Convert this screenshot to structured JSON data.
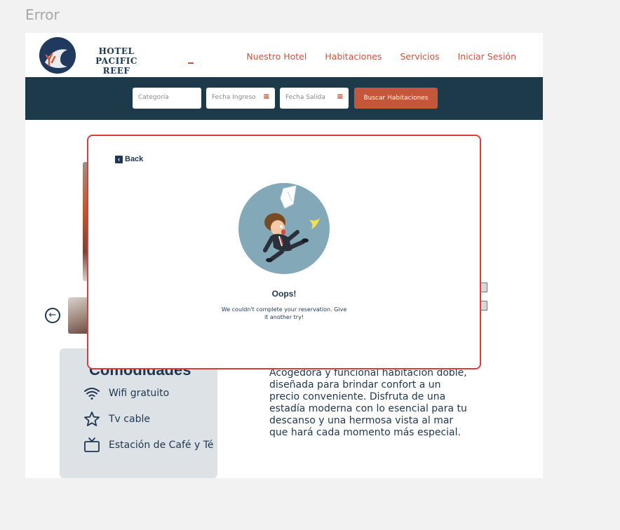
{
  "frame": {
    "title": "Error"
  },
  "header": {
    "brand_line1": "HOTEL",
    "brand_line2": "PACIFIC REEF",
    "nav": [
      "Nuestro Hotel",
      "Habitaciones",
      "Servicios",
      "Iniciar Sesión"
    ]
  },
  "search": {
    "category": "Categoría",
    "checkin": "Fecha Ingreso",
    "checkout": "Fecha Salida",
    "button": "Buscar Habitaciones"
  },
  "amenities": {
    "heading": "Comodidades",
    "items": [
      "Wifi gratuito",
      "Tv cable",
      "Estación de Café y Té"
    ],
    "icons": [
      "wifi-icon",
      "star-icon",
      "tv-icon"
    ]
  },
  "room": {
    "description": "Acogedora y funcional habitación doble, diseñada para brindar confort a un precio conveniente. Disfruta de una estadía moderna con lo esencial para tu descanso y una hermosa vista al mar que hará cada momento más especial."
  },
  "modal": {
    "back_label": "Back",
    "title": "Oops!",
    "message": "We couldn't complete your reservation. Give it another try!"
  },
  "colors": {
    "accent": "#c4573a",
    "navy": "#1d3a4b",
    "text": "#1e3650",
    "modal_border": "#e03b3b"
  }
}
